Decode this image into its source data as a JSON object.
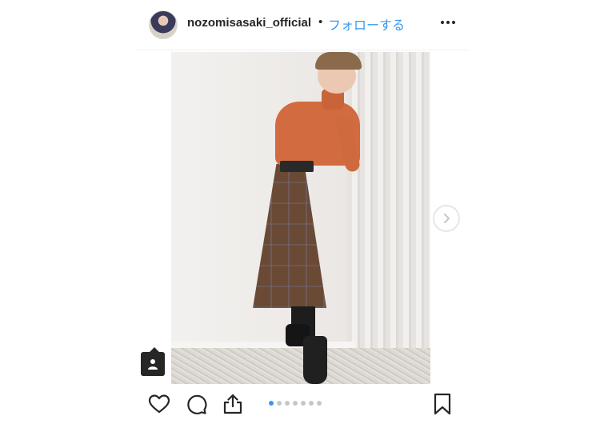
{
  "header": {
    "username": "nozomisasaki_official",
    "separator": "•",
    "follow_label": "フォローする"
  },
  "carousel": {
    "total_images": 7,
    "current_index": 1
  },
  "colors": {
    "follow_accent": "#3897f0",
    "text_primary": "#262626",
    "dot_inactive": "#c7c7c7",
    "dot_active": "#3897f0"
  },
  "icons": {
    "avatar": "profile-avatar",
    "more": "more-options-icon",
    "next": "chevron-right-icon",
    "tag": "user-tag-icon",
    "like": "heart-icon",
    "comment": "comment-icon",
    "share": "share-icon",
    "save": "bookmark-icon"
  }
}
